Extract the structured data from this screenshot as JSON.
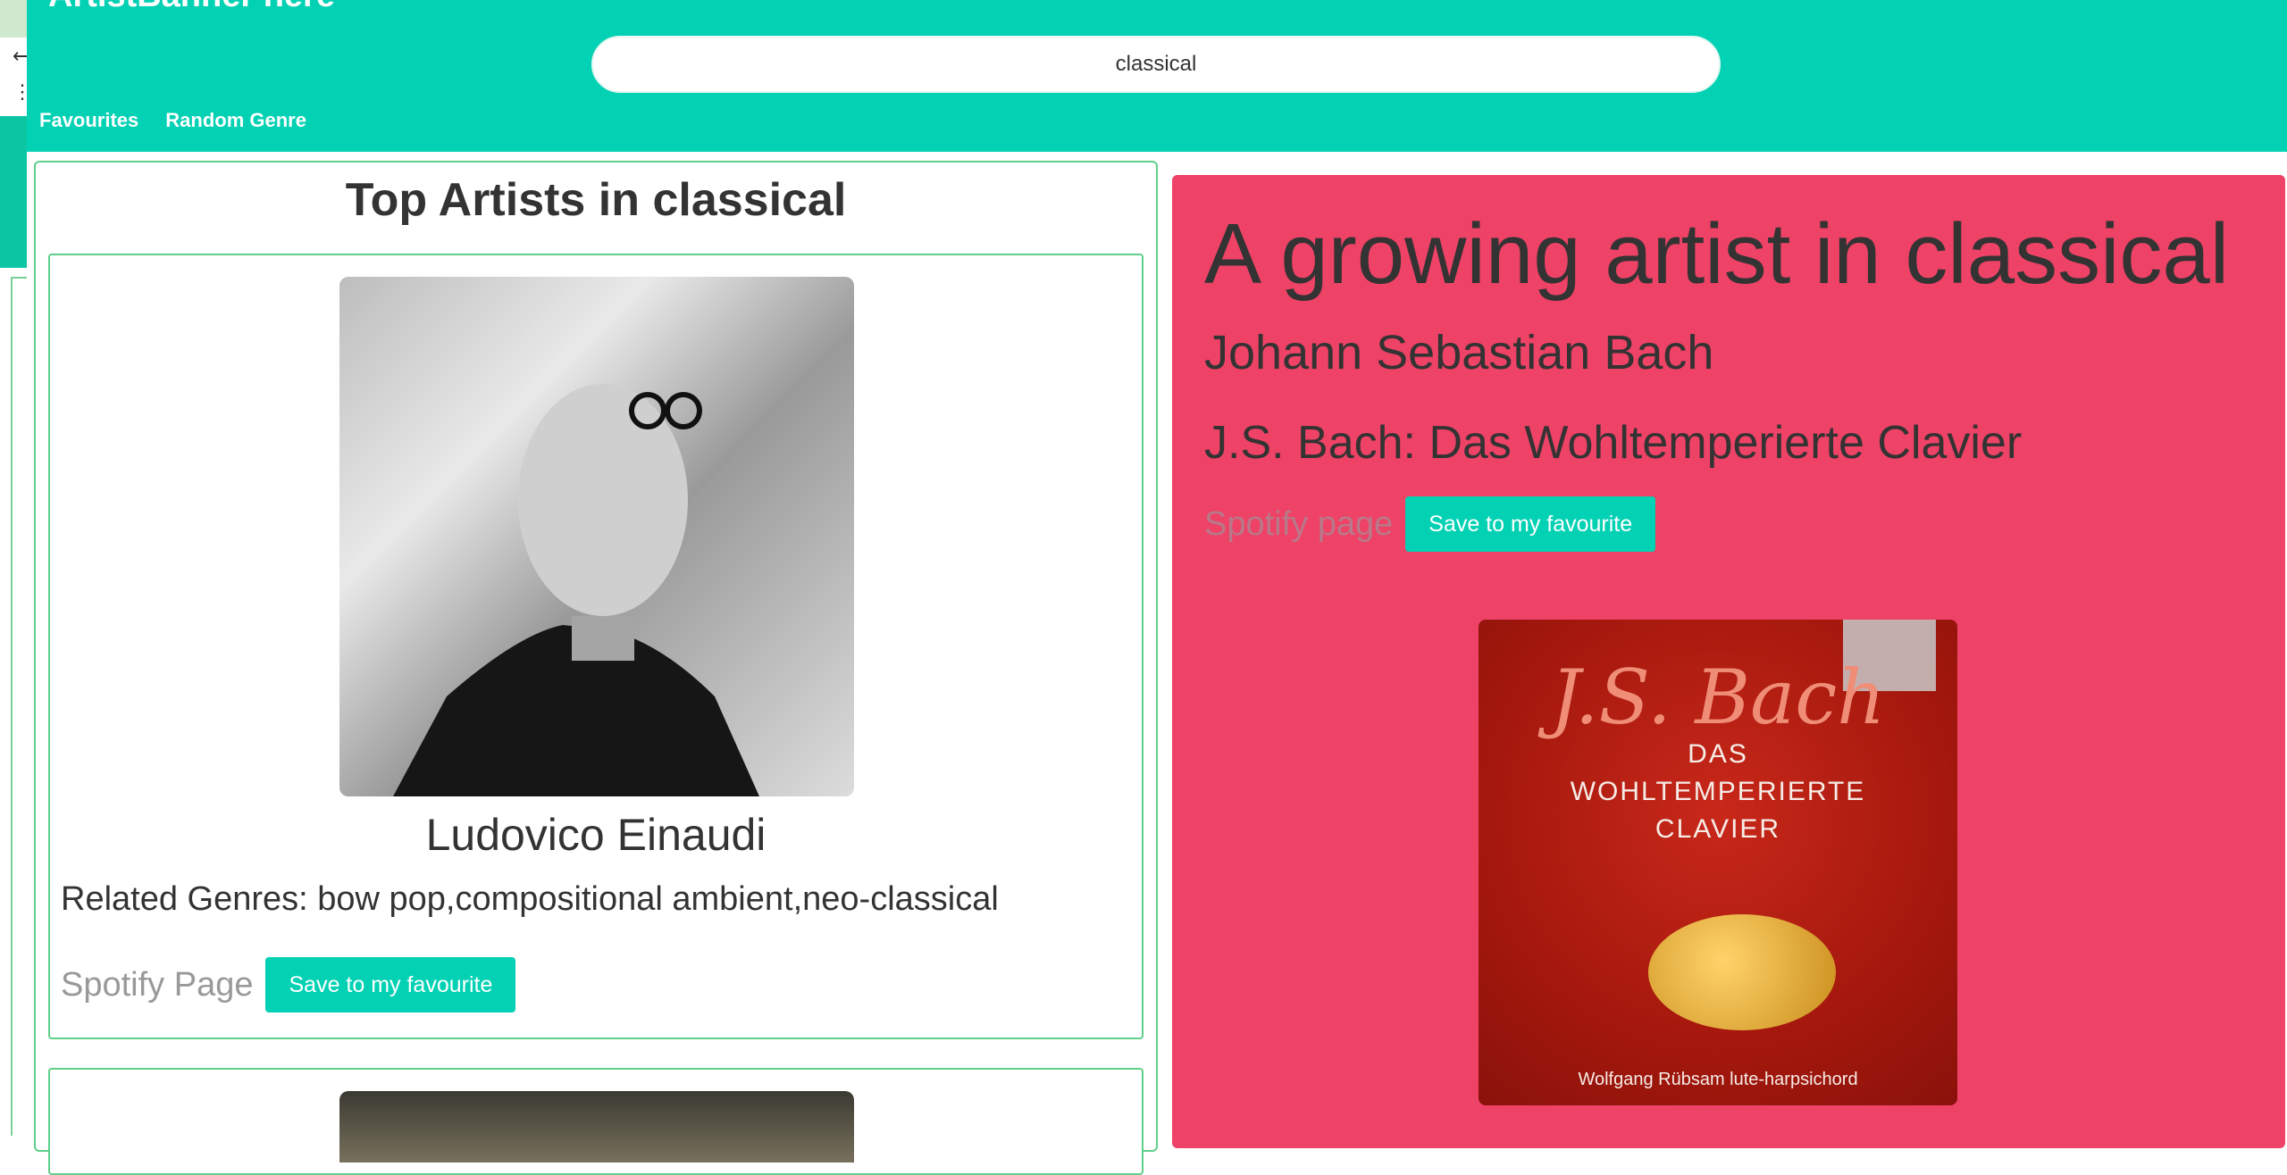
{
  "header": {
    "brand": "ArtistBanner here",
    "search_value": "classical"
  },
  "nav": [
    {
      "label": "Favourites"
    },
    {
      "label": "Random Genre"
    }
  ],
  "top_artists": {
    "title": "Top Artists in classical",
    "cards": [
      {
        "name": "Ludovico Einaudi",
        "related": "Related Genres: bow pop,compositional ambient,neo-classical",
        "spotify_label": "Spotify Page",
        "save_label": "Save to my favourite"
      }
    ]
  },
  "growing": {
    "heading": "A growing artist in classical",
    "artist": "Johann Sebastian Bach",
    "album": "J.S. Bach: Das Wohltemperierte Clavier",
    "spotify_label": "Spotify page",
    "save_label": "Save to my favourite",
    "cover": {
      "title": "J.S. Bach",
      "subtitle_line1": "DAS",
      "subtitle_line2": "WOHLTEMPERIERTE",
      "subtitle_line3": "CLAVIER",
      "performer": "Wolfgang Rübsam lute-harpsichord"
    }
  },
  "colors": {
    "header": "#02d1b3",
    "accent_panel": "#ee4266",
    "button": "#02d1b3",
    "card_border": "#5fcf8a"
  }
}
